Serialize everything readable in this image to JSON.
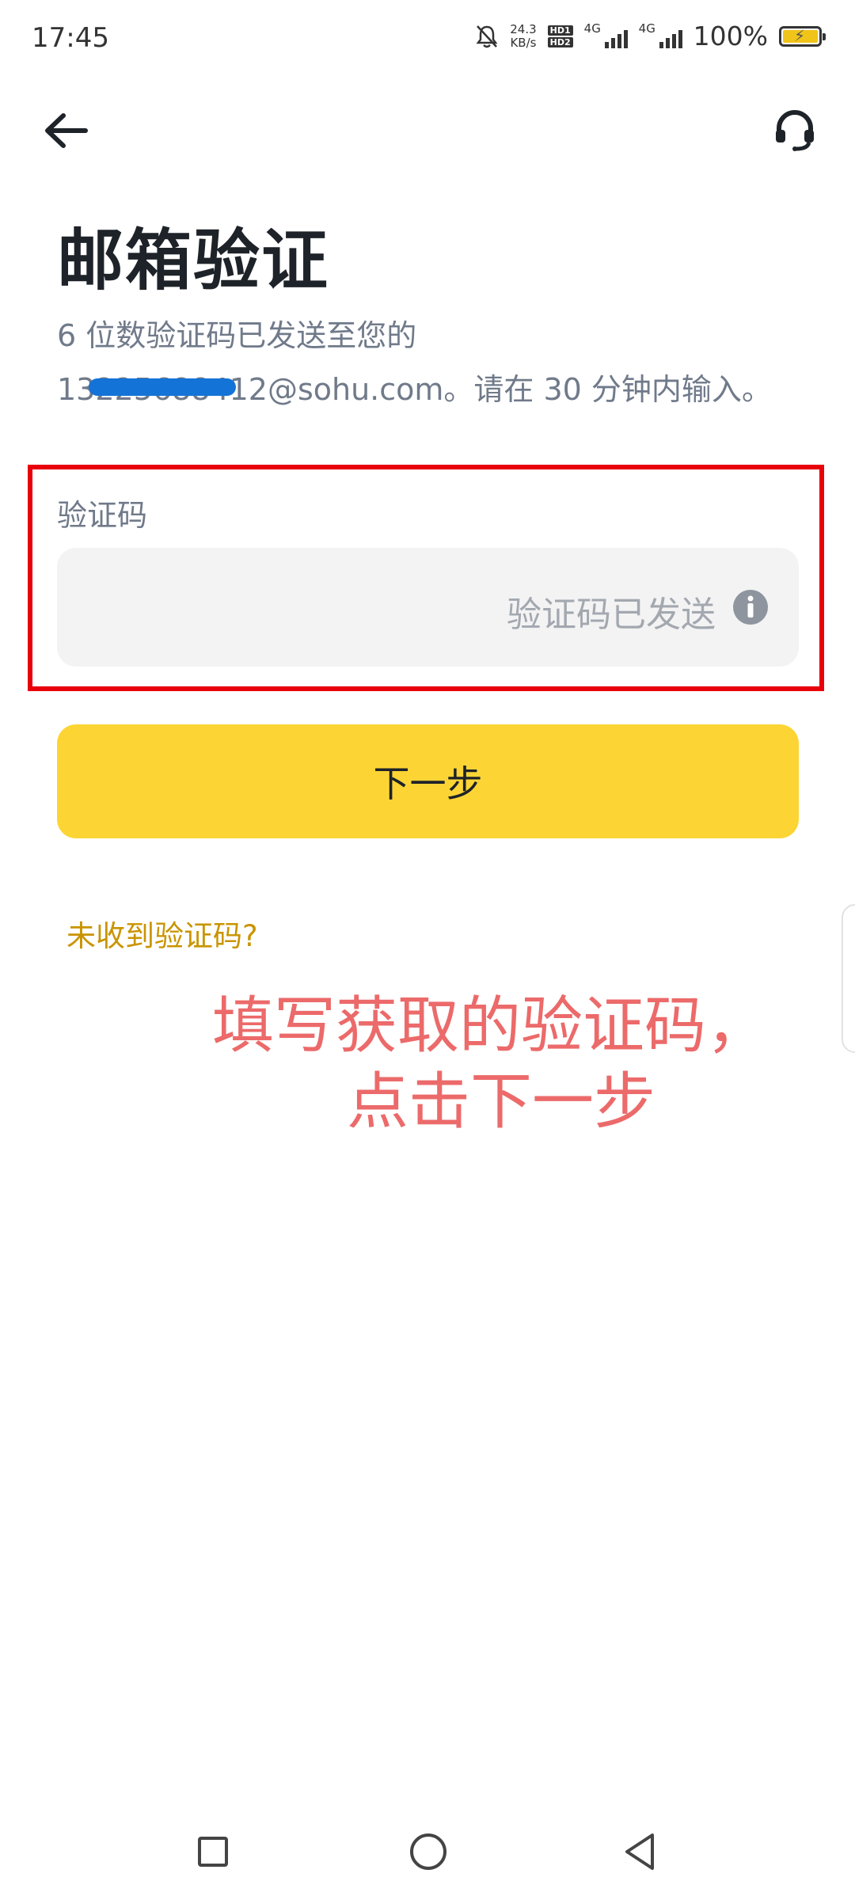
{
  "status_bar": {
    "time": "17:45",
    "net_speed_value": "24.3",
    "net_speed_unit": "KB/s",
    "hd1": "HD1",
    "hd2": "HD2",
    "sim1": "4G",
    "sim2": "4G",
    "battery": "100%"
  },
  "header": {
    "back_icon": "back-arrow-icon",
    "support_icon": "headset-icon"
  },
  "page": {
    "title": "邮箱验证",
    "subtitle_line1": "6 位数验证码已发送至您的",
    "subtitle_line2": "13225688412@sohu.com。请在 30 分钟内输入。"
  },
  "form": {
    "code_label": "验证码",
    "code_value": "",
    "code_status": "验证码已发送",
    "info_icon": "info-icon"
  },
  "actions": {
    "next_label": "下一步",
    "resend_label": "未收到验证码?"
  },
  "annotation": {
    "line1": "填写获取的验证码，",
    "line2": "点击下一步",
    "color": "#ec6a6a"
  },
  "colors": {
    "accent": "#fcd535",
    "link": "#c99400",
    "highlight_border": "#e8000b"
  }
}
